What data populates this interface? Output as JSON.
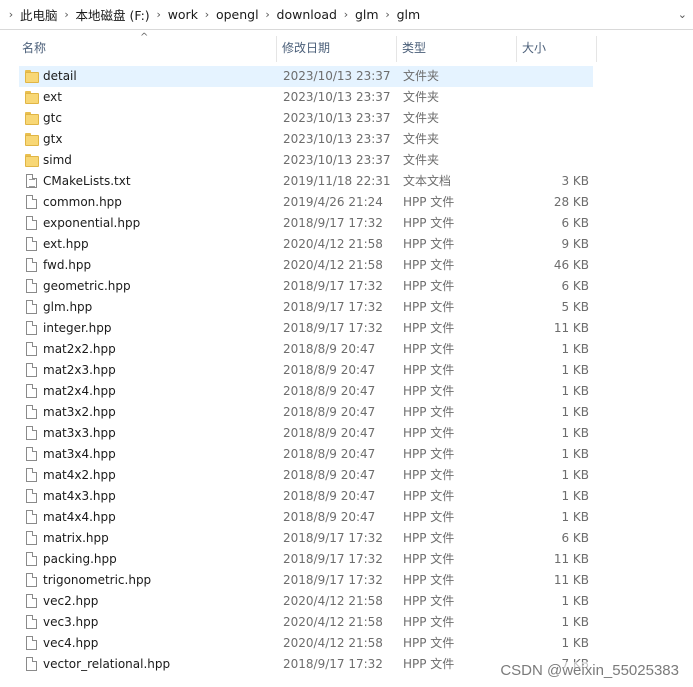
{
  "breadcrumb": [
    "此电脑",
    "本地磁盘 (F:)",
    "work",
    "opengl",
    "download",
    "glm",
    "glm"
  ],
  "columns": {
    "name": "名称",
    "date": "修改日期",
    "type": "类型",
    "size": "大小"
  },
  "rows": [
    {
      "name": "detail",
      "date": "2023/10/13 23:37",
      "type": "文件夹",
      "size": "",
      "kind": "folder"
    },
    {
      "name": "ext",
      "date": "2023/10/13 23:37",
      "type": "文件夹",
      "size": "",
      "kind": "folder"
    },
    {
      "name": "gtc",
      "date": "2023/10/13 23:37",
      "type": "文件夹",
      "size": "",
      "kind": "folder"
    },
    {
      "name": "gtx",
      "date": "2023/10/13 23:37",
      "type": "文件夹",
      "size": "",
      "kind": "folder"
    },
    {
      "name": "simd",
      "date": "2023/10/13 23:37",
      "type": "文件夹",
      "size": "",
      "kind": "folder"
    },
    {
      "name": "CMakeLists.txt",
      "date": "2019/11/18 22:31",
      "type": "文本文档",
      "size": "3 KB",
      "kind": "text"
    },
    {
      "name": "common.hpp",
      "date": "2019/4/26 21:24",
      "type": "HPP 文件",
      "size": "28 KB",
      "kind": "file"
    },
    {
      "name": "exponential.hpp",
      "date": "2018/9/17 17:32",
      "type": "HPP 文件",
      "size": "6 KB",
      "kind": "file"
    },
    {
      "name": "ext.hpp",
      "date": "2020/4/12 21:58",
      "type": "HPP 文件",
      "size": "9 KB",
      "kind": "file"
    },
    {
      "name": "fwd.hpp",
      "date": "2020/4/12 21:58",
      "type": "HPP 文件",
      "size": "46 KB",
      "kind": "file"
    },
    {
      "name": "geometric.hpp",
      "date": "2018/9/17 17:32",
      "type": "HPP 文件",
      "size": "6 KB",
      "kind": "file"
    },
    {
      "name": "glm.hpp",
      "date": "2018/9/17 17:32",
      "type": "HPP 文件",
      "size": "5 KB",
      "kind": "file"
    },
    {
      "name": "integer.hpp",
      "date": "2018/9/17 17:32",
      "type": "HPP 文件",
      "size": "11 KB",
      "kind": "file"
    },
    {
      "name": "mat2x2.hpp",
      "date": "2018/8/9 20:47",
      "type": "HPP 文件",
      "size": "1 KB",
      "kind": "file"
    },
    {
      "name": "mat2x3.hpp",
      "date": "2018/8/9 20:47",
      "type": "HPP 文件",
      "size": "1 KB",
      "kind": "file"
    },
    {
      "name": "mat2x4.hpp",
      "date": "2018/8/9 20:47",
      "type": "HPP 文件",
      "size": "1 KB",
      "kind": "file"
    },
    {
      "name": "mat3x2.hpp",
      "date": "2018/8/9 20:47",
      "type": "HPP 文件",
      "size": "1 KB",
      "kind": "file"
    },
    {
      "name": "mat3x3.hpp",
      "date": "2018/8/9 20:47",
      "type": "HPP 文件",
      "size": "1 KB",
      "kind": "file"
    },
    {
      "name": "mat3x4.hpp",
      "date": "2018/8/9 20:47",
      "type": "HPP 文件",
      "size": "1 KB",
      "kind": "file"
    },
    {
      "name": "mat4x2.hpp",
      "date": "2018/8/9 20:47",
      "type": "HPP 文件",
      "size": "1 KB",
      "kind": "file"
    },
    {
      "name": "mat4x3.hpp",
      "date": "2018/8/9 20:47",
      "type": "HPP 文件",
      "size": "1 KB",
      "kind": "file"
    },
    {
      "name": "mat4x4.hpp",
      "date": "2018/8/9 20:47",
      "type": "HPP 文件",
      "size": "1 KB",
      "kind": "file"
    },
    {
      "name": "matrix.hpp",
      "date": "2018/9/17 17:32",
      "type": "HPP 文件",
      "size": "6 KB",
      "kind": "file"
    },
    {
      "name": "packing.hpp",
      "date": "2018/9/17 17:32",
      "type": "HPP 文件",
      "size": "11 KB",
      "kind": "file"
    },
    {
      "name": "trigonometric.hpp",
      "date": "2018/9/17 17:32",
      "type": "HPP 文件",
      "size": "11 KB",
      "kind": "file"
    },
    {
      "name": "vec2.hpp",
      "date": "2020/4/12 21:58",
      "type": "HPP 文件",
      "size": "1 KB",
      "kind": "file"
    },
    {
      "name": "vec3.hpp",
      "date": "2020/4/12 21:58",
      "type": "HPP 文件",
      "size": "1 KB",
      "kind": "file"
    },
    {
      "name": "vec4.hpp",
      "date": "2020/4/12 21:58",
      "type": "HPP 文件",
      "size": "1 KB",
      "kind": "file"
    },
    {
      "name": "vector_relational.hpp",
      "date": "2018/9/17 17:32",
      "type": "HPP 文件",
      "size": "7 KB",
      "kind": "file"
    }
  ],
  "selected_index": 0,
  "watermark": "CSDN @weixin_55025383",
  "colors": {
    "selection": "#e5f3ff",
    "folder": "#f8d775",
    "header_text": "#4c607a"
  }
}
